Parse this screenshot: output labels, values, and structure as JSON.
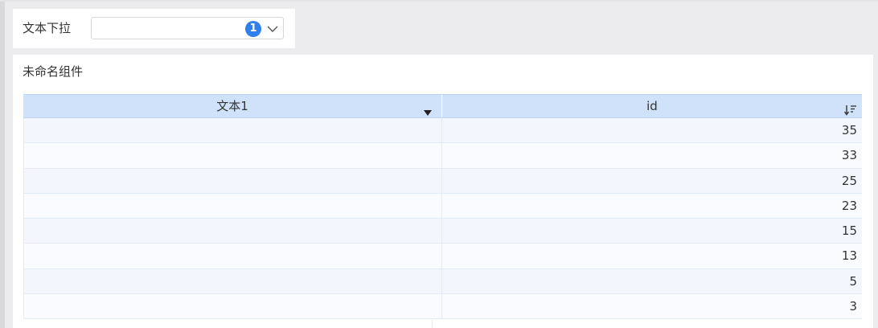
{
  "filter": {
    "label": "文本下拉",
    "selected_count": "1"
  },
  "panel": {
    "title": "未命名组件"
  },
  "table": {
    "columns": [
      "文本1",
      "id"
    ],
    "rows": [
      {
        "text1": "",
        "id": "35"
      },
      {
        "text1": "",
        "id": "33"
      },
      {
        "text1": "",
        "id": "25"
      },
      {
        "text1": "",
        "id": "23"
      },
      {
        "text1": "",
        "id": "15"
      },
      {
        "text1": "",
        "id": "13"
      },
      {
        "text1": "",
        "id": "5"
      },
      {
        "text1": "",
        "id": "3"
      }
    ]
  },
  "icons": {
    "chevron": "chevron-down-icon",
    "filter": "filter-caret-icon",
    "sort": "sort-descending-icon"
  },
  "colors": {
    "accent": "#2f80ed",
    "header_bg": "#cfe2f9"
  }
}
